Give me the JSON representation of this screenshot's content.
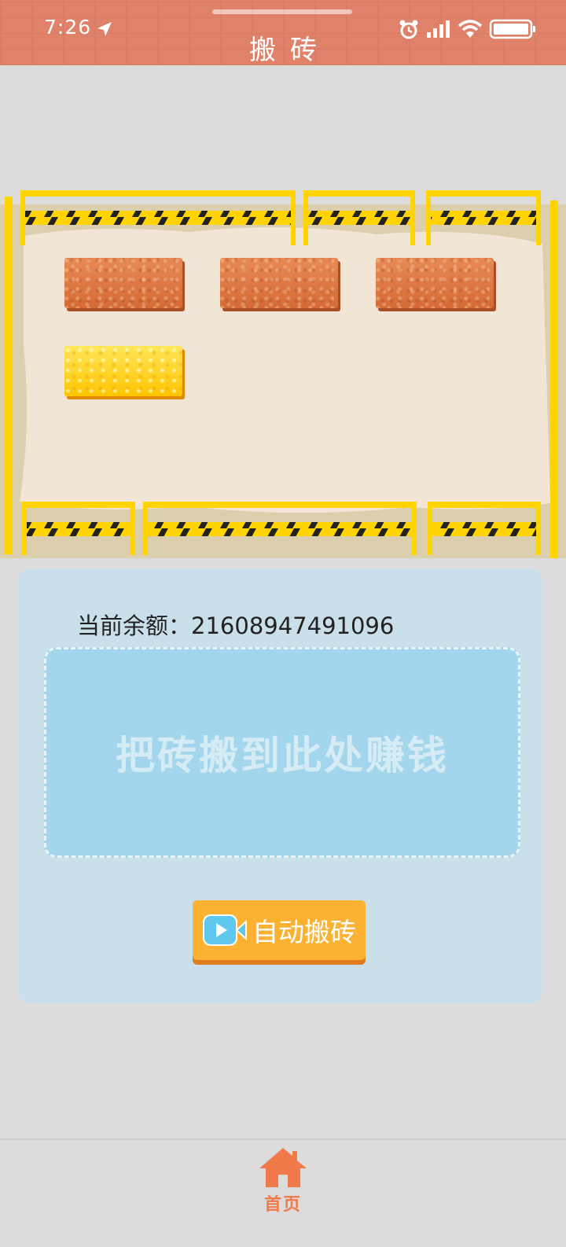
{
  "status_bar": {
    "time": "7:26"
  },
  "header": {
    "title": "搬砖"
  },
  "field": {
    "bricks": [
      {
        "type": "clay"
      },
      {
        "type": "clay"
      },
      {
        "type": "clay"
      },
      {
        "type": "gold"
      }
    ]
  },
  "panel": {
    "balance_label": "当前余额：",
    "balance_value": "21608947491096",
    "drop_hint": "把砖搬到此处赚钱",
    "auto_button_label": "自动搬砖"
  },
  "bottom_nav": {
    "home_label": "首页"
  },
  "colors": {
    "header_bg": "#e0826a",
    "accent_orange": "#f07a4a",
    "button": "#fbb132",
    "dropzone": "#a3d6ec"
  }
}
